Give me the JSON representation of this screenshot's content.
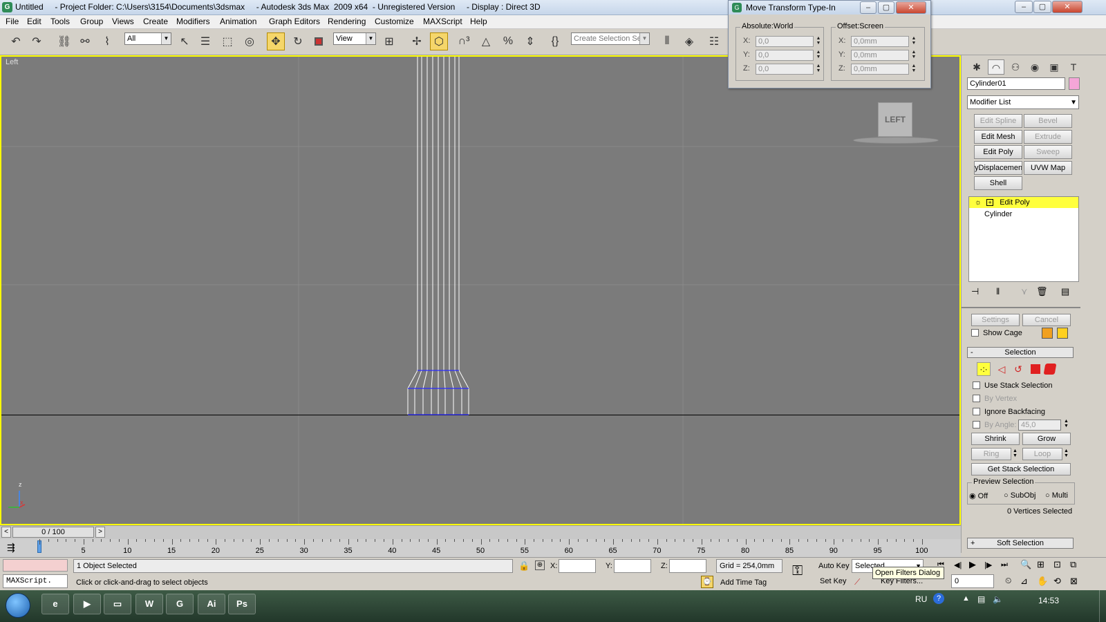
{
  "window": {
    "title": "Untitled     - Project Folder: C:\\Users\\3154\\Documents\\3dsmax     - Autodesk 3ds Max  2009 x64  - Unregistered Version     - Display : Direct 3D",
    "app_icon_letter": "G"
  },
  "menu": [
    "File",
    "Edit",
    "Tools",
    "Group",
    "Views",
    "Create",
    "Modifiers",
    "Animation",
    "Graph Editors",
    "Rendering",
    "Customize",
    "MAXScript",
    "Help"
  ],
  "toolbar": {
    "selection_filter": "All",
    "reference_coord": "View",
    "named_selection": "Create Selection Set",
    "icons": [
      "undo-icon",
      "redo-icon",
      "select-link-icon",
      "unlink-icon",
      "bind-space-warp-icon",
      "select-object-icon",
      "select-by-name-icon",
      "rectangle-selection-icon",
      "window-crossing-icon",
      "move-icon",
      "rotate-icon",
      "scale-icon",
      "pivot-icon",
      "manipulate-icon",
      "snaps-icon",
      "angle-snap-icon",
      "percent-snap-icon",
      "spinner-snap-icon",
      "edit-named-selection-icon",
      "mirror-icon",
      "align-icon",
      "layer-manager-icon"
    ]
  },
  "viewport": {
    "label": "Left",
    "viewcube_label": "LEFT",
    "axis_z": "z",
    "axis_x": "x"
  },
  "typein": {
    "title": "Move Transform Type-In",
    "absolute": {
      "label": "Absolute:World",
      "x_label": "X:",
      "y_label": "Y:",
      "z_label": "Z:",
      "x": "0,0",
      "y": "0,0",
      "z": "0,0"
    },
    "offset": {
      "label": "Offset:Screen",
      "x_label": "X:",
      "y_label": "Y:",
      "z_label": "Z:",
      "x": "0,0mm",
      "y": "0,0mm",
      "z": "0,0mm"
    }
  },
  "command_panel": {
    "object_name": "Cylinder01",
    "modifier_list": "Modifier List",
    "buttons": {
      "edit_spline": "Edit Spline",
      "bevel": "Bevel",
      "edit_mesh": "Edit Mesh",
      "extrude": "Extrude",
      "edit_poly": "Edit Poly",
      "sweep": "Sweep",
      "displacement": "yDisplacement",
      "uvw_map": "UVW Map",
      "shell": "Shell"
    },
    "stack": [
      "Edit Poly",
      "Cylinder"
    ],
    "settings": "Settings",
    "cancel": "Cancel",
    "show_cage": "Show Cage",
    "selection_rollout": "Selection",
    "use_stack_selection": "Use Stack Selection",
    "by_vertex": "By Vertex",
    "ignore_backfacing": "Ignore Backfacing",
    "by_angle": "By Angle:",
    "by_angle_value": "45,0",
    "shrink": "Shrink",
    "grow": "Grow",
    "ring": "Ring",
    "loop": "Loop",
    "get_stack_selection": "Get Stack Selection",
    "preview_selection": "Preview Selection",
    "preview_off": "Off",
    "preview_subobj": "SubObj",
    "preview_multi": "Multi",
    "vertices_selected": "0 Vertices Selected",
    "soft_selection": "Soft Selection",
    "cage_color": "#f0a020",
    "cage_color2": "#ffd020"
  },
  "timeline": {
    "frame_counter": "0 / 100",
    "ticks": [
      "5",
      "10",
      "15",
      "20",
      "25",
      "30",
      "35",
      "40",
      "45",
      "50",
      "55",
      "60",
      "65",
      "70",
      "75",
      "80",
      "85",
      "90",
      "95",
      "100"
    ]
  },
  "status": {
    "objects_selected": "1 Object Selected",
    "prompt": "Click or click-and-drag to select objects",
    "maxscript": "MAXScript.",
    "x_label": "X:",
    "y_label": "Y:",
    "z_label": "Z:",
    "grid": "Grid = 254,0mm",
    "add_time_tag": "Add Time Tag",
    "auto_key": "Auto Key",
    "set_key": "Set Key",
    "selected": "Selected",
    "key_filters": "Key Filters...",
    "current_frame": "0",
    "tooltip": "Open Filters Dialog"
  },
  "taskbar": {
    "language": "RU",
    "clock": "14:53",
    "apps": [
      {
        "name": "ie",
        "label": "e"
      },
      {
        "name": "media",
        "label": "▶"
      },
      {
        "name": "explorer",
        "label": "▭"
      },
      {
        "name": "word",
        "label": "W"
      },
      {
        "name": "3dsmax",
        "label": "G"
      },
      {
        "name": "illustrator",
        "label": "Ai"
      },
      {
        "name": "photoshop",
        "label": "Ps"
      }
    ]
  }
}
